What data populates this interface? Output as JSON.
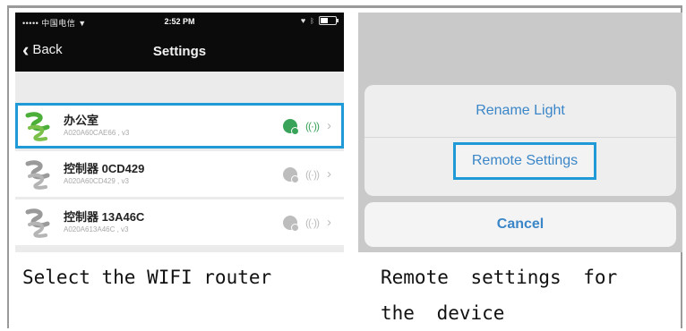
{
  "status_bar": {
    "carrier": "••••• 中国电信 ▼",
    "time": "2:52 PM"
  },
  "navbar": {
    "back_label": "Back",
    "title": "Settings"
  },
  "devices": [
    {
      "name": "办公室",
      "mac": "A020A60CAE66 , v3",
      "selected": true
    },
    {
      "name": "控制器 0CD429",
      "mac": "A020A60CD429 , v3",
      "selected": false
    },
    {
      "name": "控制器 13A46C",
      "mac": "A020A613A46C , v3",
      "selected": false
    }
  ],
  "action_sheet": {
    "rename_label": "Rename Light",
    "remote_label": "Remote Settings",
    "cancel_label": "Cancel"
  },
  "captions": {
    "left": "Select the WIFI router",
    "right": "Remote settings for the device"
  },
  "colors": {
    "selection_outline": "#1f9ad6",
    "ios_blue": "#3a86c8",
    "online_green": "#3aa35a",
    "offline_gray": "#bdbdbd"
  }
}
